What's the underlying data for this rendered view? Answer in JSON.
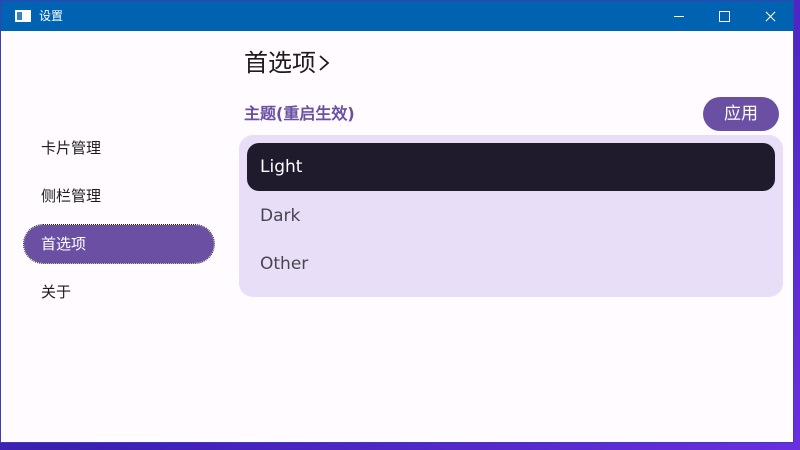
{
  "window": {
    "title": "设置"
  },
  "sidebar": {
    "items": [
      {
        "label": "卡片管理"
      },
      {
        "label": "侧栏管理"
      },
      {
        "label": "首选项"
      },
      {
        "label": "关于"
      }
    ]
  },
  "main": {
    "page_title": "首选项",
    "section_label": "主题(重启生效)",
    "apply_label": "应用",
    "theme_options": [
      {
        "label": "Light",
        "selected": true
      },
      {
        "label": "Dark",
        "selected": false
      },
      {
        "label": "Other",
        "selected": false
      }
    ]
  },
  "colors": {
    "titlebar": "#0063b1",
    "accent": "#6a4fa3",
    "list_background": "#e8def8",
    "selected_option": "#1f1a2c"
  },
  "icons": [
    "app-icon",
    "minimize-icon",
    "maximize-icon",
    "close-icon",
    "chevron-right-icon"
  ]
}
